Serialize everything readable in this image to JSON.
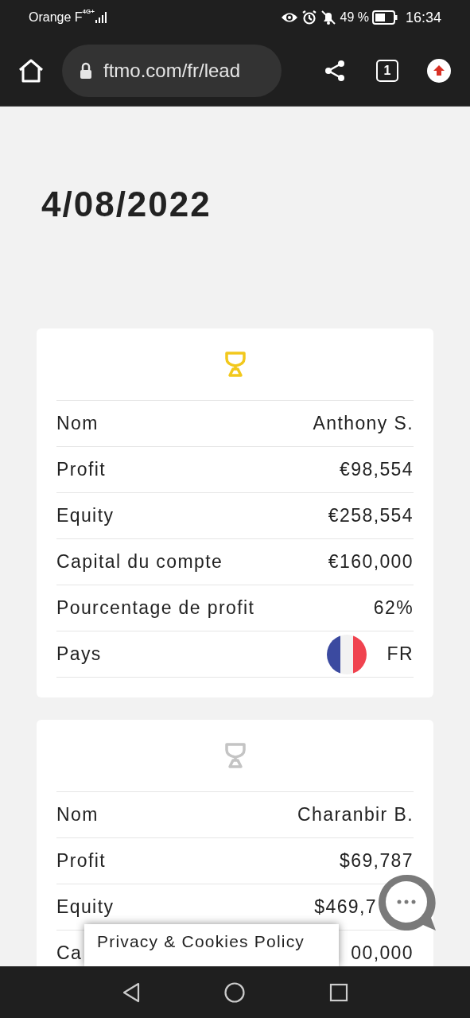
{
  "status_bar": {
    "carrier": "Orange F",
    "network": "4G+",
    "battery": "49 %",
    "time": "16:34"
  },
  "browser": {
    "url": "ftmo.com/fr/lead",
    "tab_count": "1"
  },
  "date": "4/08/2022",
  "cards": [
    {
      "color": "#f2c81c",
      "rows": [
        {
          "kind": "text",
          "label": "Nom",
          "value": "Anthony S."
        },
        {
          "kind": "text",
          "label": "Profit",
          "value": "€98,554"
        },
        {
          "kind": "text",
          "label": "Equity",
          "value": "€258,554"
        },
        {
          "kind": "text",
          "label": "Capital du compte",
          "value": "€160,000"
        },
        {
          "kind": "text",
          "label": "Pourcentage de profit",
          "value": "62%"
        },
        {
          "kind": "country",
          "label": "Pays",
          "value": "FR"
        }
      ]
    },
    {
      "color": "#c4c4c4",
      "rows": [
        {
          "kind": "text",
          "label": "Nom",
          "value": "Charanbir B."
        },
        {
          "kind": "text",
          "label": "Profit",
          "value": "$69,787"
        },
        {
          "kind": "text",
          "label": "Equity",
          "value": "$469,7"
        },
        {
          "kind": "text",
          "label": "Ca",
          "value": "00,000"
        }
      ]
    }
  ],
  "cookie_banner": {
    "label": "Privacy & Cookies Policy"
  }
}
